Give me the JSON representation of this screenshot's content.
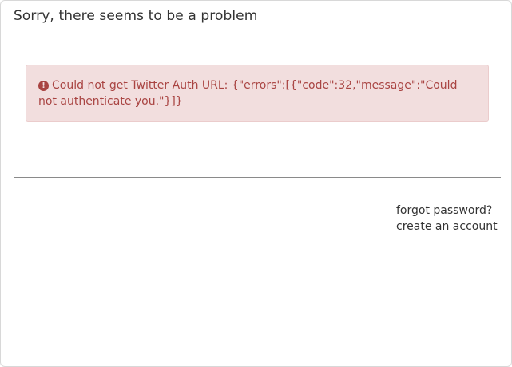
{
  "dialog": {
    "title": "Sorry, there seems to be a problem"
  },
  "alert": {
    "icon": "exclamation-circle-icon",
    "icon_glyph": "!",
    "message": "Could not get Twitter Auth URL: {\"errors\":[{\"code\":32,\"message\":\"Could not authenticate you.\"}]}",
    "color_text": "#a94442",
    "color_background": "#f2dede"
  },
  "links": {
    "forgot_password": "forgot password?",
    "create_account": "create an account"
  }
}
